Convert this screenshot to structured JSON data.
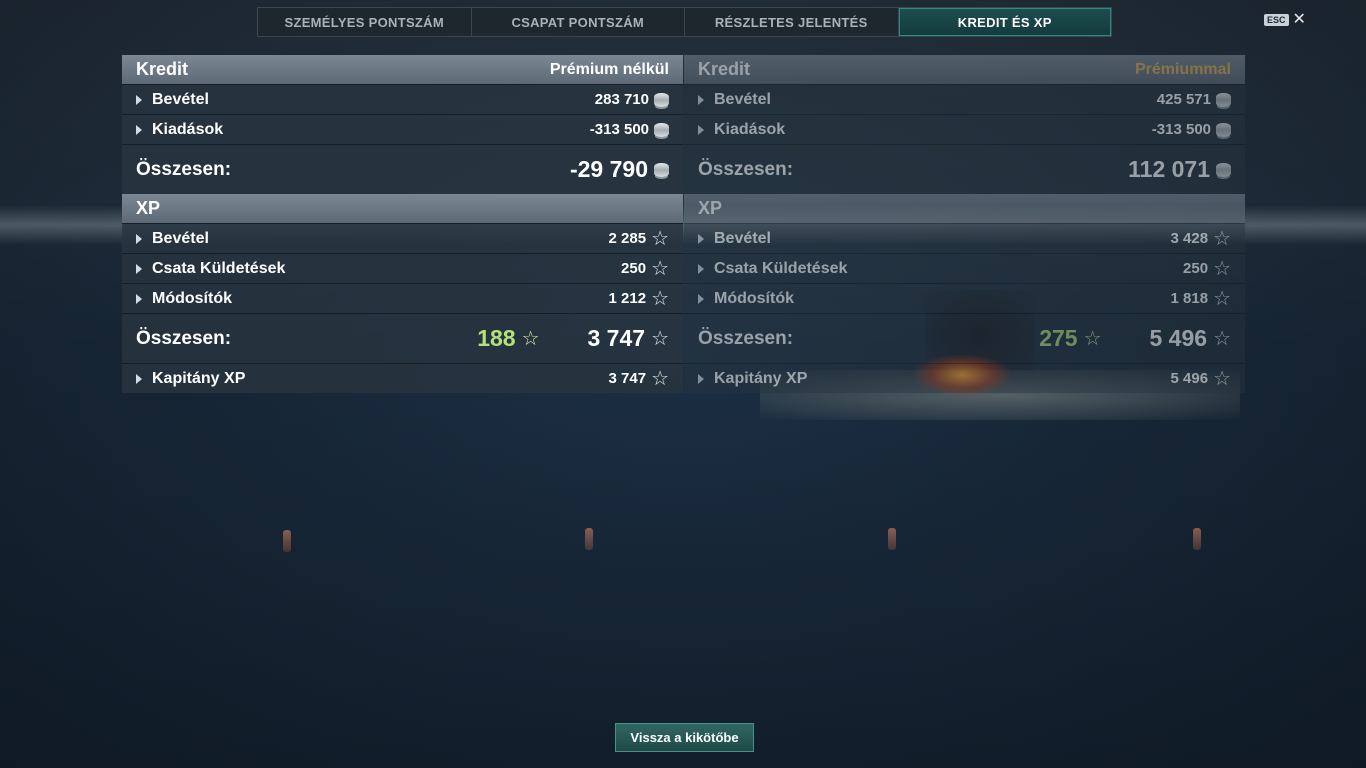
{
  "tabs": [
    {
      "label": "SZEMÉLYES PONTSZÁM",
      "active": false
    },
    {
      "label": "CSAPAT PONTSZÁM",
      "active": false
    },
    {
      "label": "RÉSZLETES JELENTÉS",
      "active": false
    },
    {
      "label": "KREDIT ÉS XP",
      "active": true
    }
  ],
  "esc": {
    "key": "ESC",
    "close": "✕"
  },
  "left": {
    "credit": {
      "title": "Kredit",
      "subtitle": "Prémium nélkül",
      "rows": [
        {
          "label": "Bevétel",
          "value": "283 710"
        },
        {
          "label": "Kiadások",
          "value": "-313 500"
        }
      ],
      "total_label": "Összesen:",
      "total_value": "-29 790"
    },
    "xp": {
      "title": "XP",
      "rows": [
        {
          "label": "Bevétel",
          "value": "2 285"
        },
        {
          "label": "Csata Küldetések",
          "value": "250"
        },
        {
          "label": "Módosítók",
          "value": "1 212"
        }
      ],
      "total_label": "Összesen:",
      "bonus_value": "188",
      "total_value": "3 747",
      "captain_label": "Kapitány XP",
      "captain_value": "3 747"
    }
  },
  "right": {
    "credit": {
      "title": "Kredit",
      "subtitle": "Prémiummal",
      "rows": [
        {
          "label": "Bevétel",
          "value": "425 571"
        },
        {
          "label": "Kiadások",
          "value": "-313 500"
        }
      ],
      "total_label": "Összesen:",
      "total_value": "112 071"
    },
    "xp": {
      "title": "XP",
      "rows": [
        {
          "label": "Bevétel",
          "value": "3 428"
        },
        {
          "label": "Csata Küldetések",
          "value": "250"
        },
        {
          "label": "Módosítók",
          "value": "1 818"
        }
      ],
      "total_label": "Összesen:",
      "bonus_value": "275",
      "total_value": "5 496",
      "captain_label": "Kapitány XP",
      "captain_value": "5 496"
    }
  },
  "footer": {
    "back_label": "Vissza a kikötőbe"
  },
  "icons": {
    "credit": "silver-coin-icon",
    "xp": "star-icon",
    "expand": "triangle-right-icon"
  },
  "colors": {
    "accent": "#1d4e50",
    "bonus_green": "#b6e07a",
    "premium_gold": "#e0b05a"
  }
}
